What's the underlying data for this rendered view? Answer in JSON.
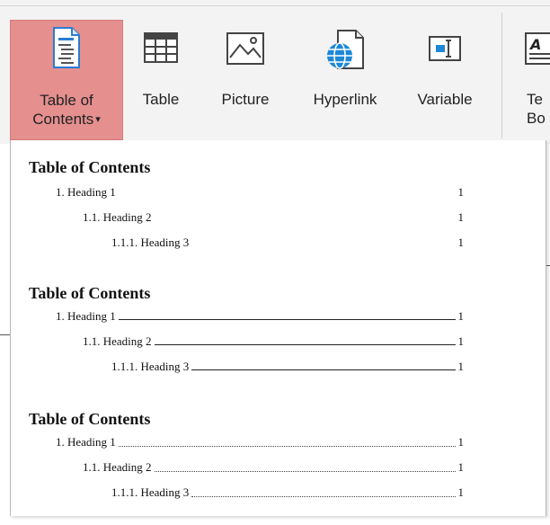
{
  "ribbon": {
    "buttons": [
      {
        "id": "toc",
        "line1": "Table of",
        "line2": "Contents",
        "icon": "document-toc-icon"
      },
      {
        "id": "table",
        "line1": "Table",
        "icon": "table-icon"
      },
      {
        "id": "picture",
        "line1": "Picture",
        "icon": "picture-icon"
      },
      {
        "id": "hyperlink",
        "line1": "Hyperlink",
        "icon": "globe-document-icon"
      },
      {
        "id": "variable",
        "line1": "Variable",
        "icon": "variable-field-icon"
      },
      {
        "id": "textbox",
        "line1": "Te",
        "line2": "Bo",
        "icon": "textbox-icon"
      }
    ],
    "active_color": "#e58f8f"
  },
  "toc_gallery": [
    {
      "style": "none",
      "title": "Table of Contents",
      "entries": [
        {
          "text": "1. Heading 1",
          "page": "1"
        },
        {
          "text": "1.1. Heading 2",
          "page": "1"
        },
        {
          "text": "1.1.1. Heading 3",
          "page": "1"
        }
      ]
    },
    {
      "style": "solid",
      "title": "Table of Contents",
      "entries": [
        {
          "text": "1. Heading 1",
          "page": "1"
        },
        {
          "text": "1.1. Heading 2",
          "page": "1"
        },
        {
          "text": "1.1.1. Heading 3",
          "page": "1"
        }
      ]
    },
    {
      "style": "dotted",
      "title": "Table of Contents",
      "entries": [
        {
          "text": "1. Heading 1",
          "page": "1"
        },
        {
          "text": "1.1. Heading 2",
          "page": "1"
        },
        {
          "text": "1.1.1. Heading 3",
          "page": "1"
        }
      ]
    }
  ]
}
